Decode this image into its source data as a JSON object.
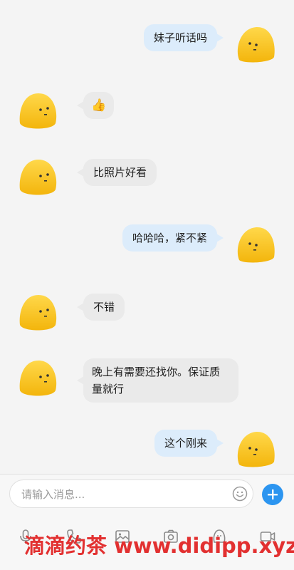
{
  "chat": {
    "messages": [
      {
        "side": "right",
        "text": "妹子听话吗"
      },
      {
        "side": "left",
        "text": "👍"
      },
      {
        "side": "left",
        "text": "比照片好看"
      },
      {
        "side": "right",
        "text": "哈哈哈，紧不紧"
      },
      {
        "side": "left",
        "text": "不错"
      },
      {
        "side": "left",
        "text": "晚上有需要还找你。保证质量就行"
      },
      {
        "side": "right",
        "text": "这个刚来"
      }
    ]
  },
  "input": {
    "placeholder": "请输入消息..."
  },
  "toolbar": {
    "icons": [
      "microphone-icon",
      "phone-icon",
      "image-icon",
      "camera-icon",
      "smiley-icon",
      "video-call-icon"
    ]
  },
  "watermark": {
    "text": "滴滴约茶 www.didipp.xyz"
  },
  "colors": {
    "accent": "#2c95f0",
    "bubble_right": "#dcecfb",
    "bubble_left": "#eaeaea",
    "avatar": "#f5c316",
    "watermark": "#e23030"
  }
}
